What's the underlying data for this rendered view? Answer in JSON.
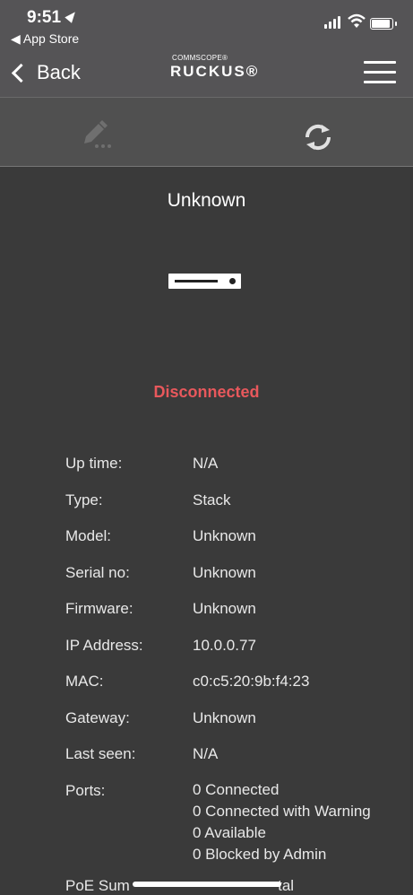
{
  "status_bar": {
    "time": "9:51",
    "back_app": "◀ App Store"
  },
  "nav": {
    "back_label": "Back",
    "logo_top": "COMMSCOPE®",
    "logo_main": "RUCKUS®"
  },
  "device": {
    "title": "Unknown",
    "status": "Disconnected",
    "status_color": "#e8585c"
  },
  "properties": [
    {
      "label": "Up time:",
      "value": "N/A"
    },
    {
      "label": "Type:",
      "value": "Stack"
    },
    {
      "label": "Model:",
      "value": "Unknown"
    },
    {
      "label": "Serial no:",
      "value": "Unknown"
    },
    {
      "label": "Firmware:",
      "value": "Unknown"
    },
    {
      "label": "IP Address:",
      "value": "10.0.0.77"
    },
    {
      "label": "MAC:",
      "value": "c0:c5:20:9b:f4:23"
    },
    {
      "label": "Gateway:",
      "value": "Unknown"
    },
    {
      "label": "Last seen:",
      "value": "N/A"
    }
  ],
  "ports": {
    "label": "Ports:",
    "values": [
      "0 Connected",
      "0 Connected with Warning",
      "0 Available",
      "0 Blocked by Admin"
    ]
  },
  "cutoff_row": "PoE Sum                                   tal",
  "icons": {
    "edit": "pencil-icon",
    "refresh": "refresh-icon",
    "menu": "hamburger-menu-icon",
    "back": "chevron-left-icon"
  }
}
